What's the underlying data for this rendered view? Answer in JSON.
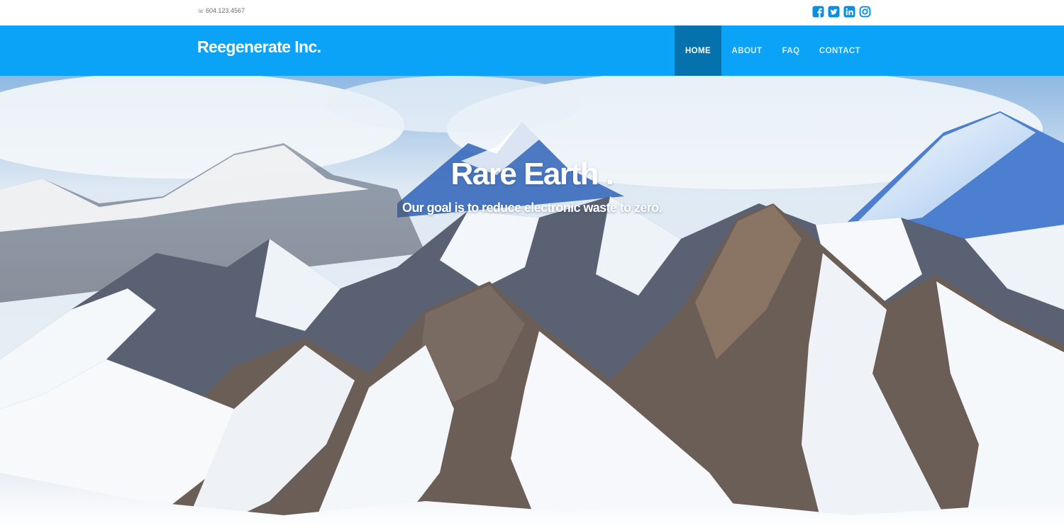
{
  "topbar": {
    "phone_icon": "phone-icon",
    "phone": "604.123.4567",
    "social": [
      {
        "icon": "facebook-icon"
      },
      {
        "icon": "twitter-icon"
      },
      {
        "icon": "linkedin-icon"
      },
      {
        "icon": "instagram-icon"
      }
    ],
    "social_color": "#0a8fe0"
  },
  "navbar": {
    "brand": "Reegenerate Inc.",
    "background": "#0aa3f7",
    "active_background": "#0572ad",
    "items": [
      {
        "label": "HOME",
        "active": true
      },
      {
        "label": "ABOUT",
        "active": false
      },
      {
        "label": "FAQ",
        "active": false
      },
      {
        "label": "CONTACT",
        "active": false
      }
    ]
  },
  "hero": {
    "title": "Rare Earth .",
    "subtitle": "Our goal is to reduce electronic waste to zero.",
    "background_image": "snowy-mountain-range"
  }
}
